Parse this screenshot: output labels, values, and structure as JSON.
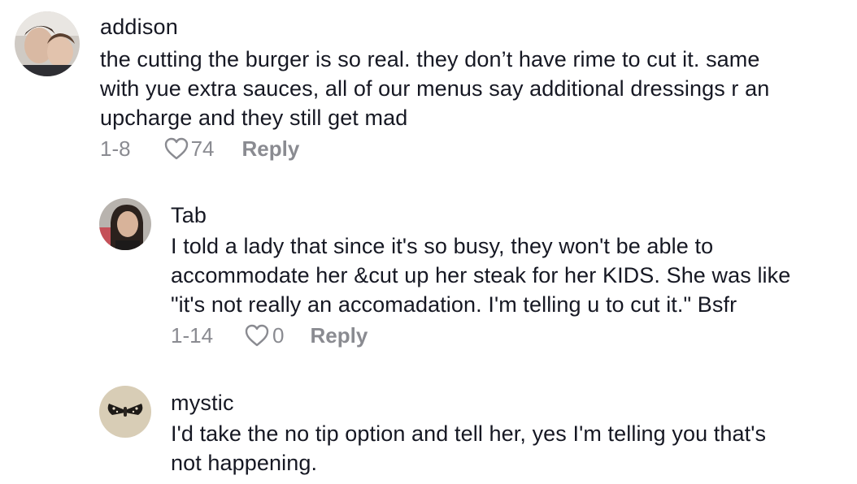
{
  "comments": [
    {
      "username": "addison",
      "text": "the cutting the burger is so real. they don’t have rime to cut it. same\nwith yue extra sauces, all of our menus say additional dressings r an\nupcharge and they still get mad",
      "date": "1-8",
      "likes": "74",
      "reply_label": "Reply",
      "avatar_icon": "profile-photo-two-people"
    },
    {
      "username": "Tab",
      "text": "I told a lady that since it's so busy, they won't be able to\naccommodate her &cut up her steak for her KIDS. She was like\n\"it's not really an accomadation. I'm telling u to cut it.\" Bsfr",
      "date": "1-14",
      "likes": "0",
      "reply_label": "Reply",
      "avatar_icon": "profile-photo-woman"
    },
    {
      "username": "mystic",
      "text": "I'd take the no tip option and tell her, yes I'm telling you that's\nnot happening.",
      "avatar_icon": "profile-photo-moth"
    }
  ],
  "colors": {
    "text": "#161823",
    "secondary": "#8a8b91",
    "background": "#ffffff"
  }
}
